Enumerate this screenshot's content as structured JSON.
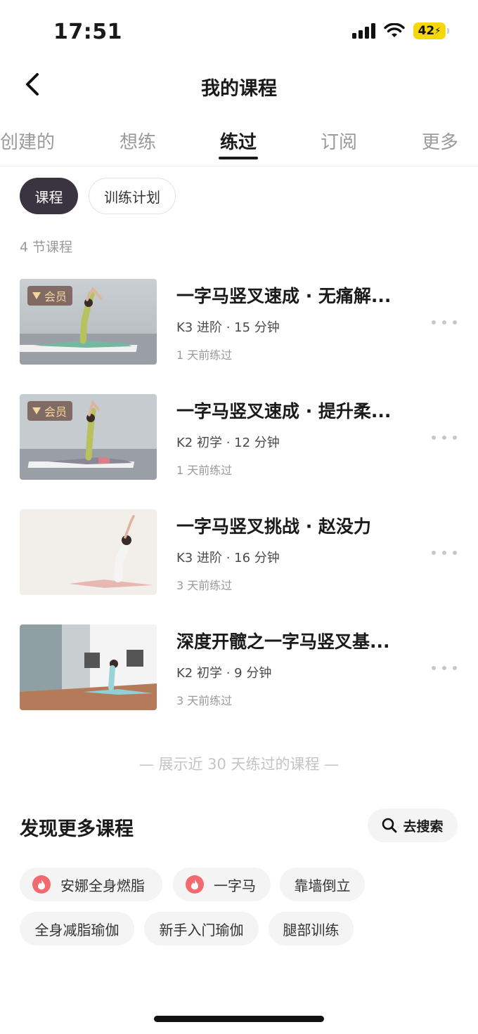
{
  "status_bar": {
    "time": "17:51",
    "battery": "42"
  },
  "header": {
    "title": "我的课程"
  },
  "tabs": [
    {
      "label": "创建的"
    },
    {
      "label": "想练"
    },
    {
      "label": "练过",
      "active": true
    },
    {
      "label": "订阅"
    },
    {
      "label": "更多"
    }
  ],
  "segments": [
    {
      "label": "课程",
      "active": true
    },
    {
      "label": "训练计划"
    }
  ],
  "course_count": "4 节课程",
  "courses": [
    {
      "title": "一字马竖叉速成 · 无痛解...",
      "meta": "K3 进阶 · 15 分钟",
      "last": "1 天前练过",
      "vip": "会员"
    },
    {
      "title": "一字马竖叉速成 · 提升柔...",
      "meta": "K2 初学 · 12 分钟",
      "last": "1 天前练过",
      "vip": "会员"
    },
    {
      "title": "一字马竖叉挑战 · 赵没力",
      "meta": "K3 进阶 · 16 分钟",
      "last": "3 天前练过"
    },
    {
      "title": "深度开髋之一字马竖叉基...",
      "meta": "K2 初学 · 9 分钟",
      "last": "3 天前练过"
    }
  ],
  "footer_note": "— 展示近 30 天练过的课程 —",
  "discover": {
    "title": "发现更多课程",
    "search_label": "去搜索",
    "tags": [
      {
        "label": "安娜全身燃脂",
        "hot": true
      },
      {
        "label": "一字马",
        "hot": true
      },
      {
        "label": "靠墙倒立"
      },
      {
        "label": "全身减脂瑜伽"
      },
      {
        "label": "新手入门瑜伽"
      },
      {
        "label": "腿部训练"
      }
    ]
  },
  "colors": {
    "accent_dark": "#3a3440",
    "hot_icon": "#f2696f",
    "vip_text": "#f4d6a0",
    "battery": "#f6d70a"
  }
}
